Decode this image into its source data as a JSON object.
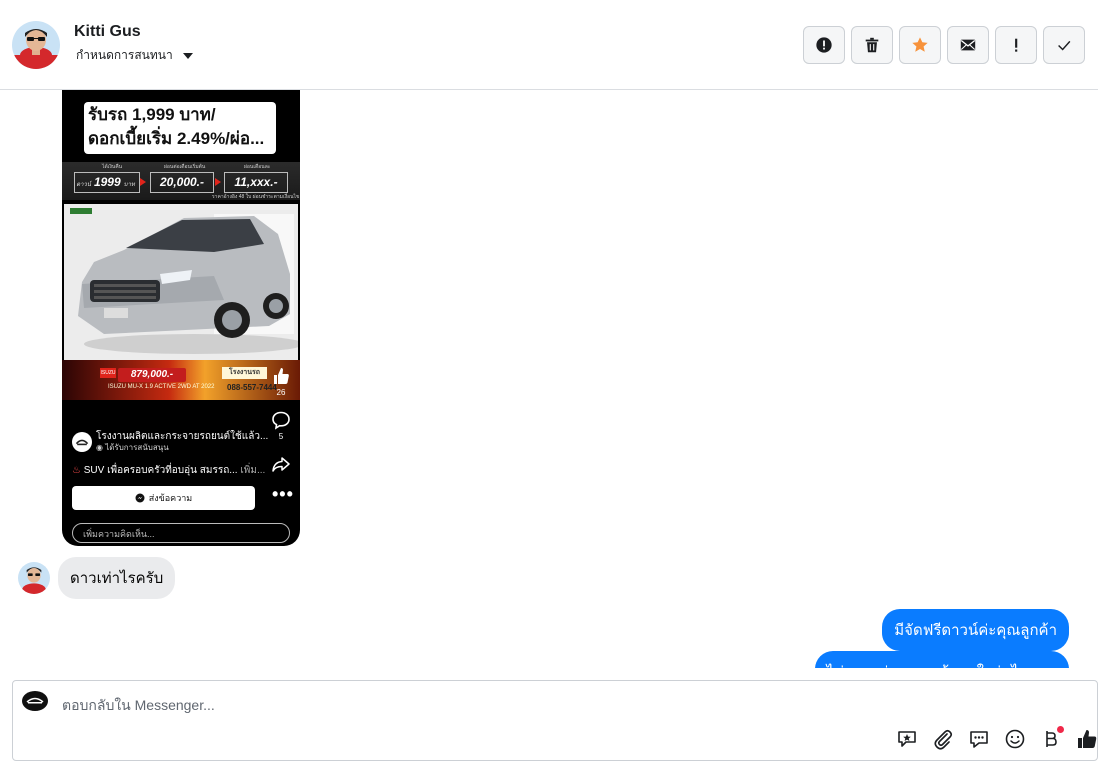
{
  "header": {
    "name": "Kitti Gus",
    "assign_label": "กำหนดการสนทนา",
    "actions": [
      {
        "icon": "alert-circle-icon",
        "name": "spam-button"
      },
      {
        "icon": "trash-icon",
        "name": "delete-button"
      },
      {
        "icon": "star-icon",
        "name": "star-button"
      },
      {
        "icon": "envelope-icon",
        "name": "mark-unread-button"
      },
      {
        "icon": "exclamation-icon",
        "name": "follow-up-button"
      },
      {
        "icon": "check-icon",
        "name": "done-button"
      }
    ],
    "star_color": "#f7923b"
  },
  "post": {
    "title": "รับรถ 1,999 บาท/ ดอกเบี้ยเริ่ม 2.49%/ผ่อ...",
    "price_caps": [
      "ได้เงินคืน",
      "ผ่อนต่อเดือนเริ่มต้น",
      "ผ่อนเดือนละ"
    ],
    "down_prefix": "ดาวน์",
    "down_value": "1999",
    "down_unit": "บาท",
    "cash_value": "20,000.-",
    "monthly_value": "11,xxx.-",
    "strip_note": "ราคาอ้างอิง 48 ใบ ผ่อนชำระตามเงื่อนไข",
    "banner_tag": "ISUZU",
    "banner_price": "879,000.-",
    "banner_sub": "ISUZU MU-X 1.9 ACTIVE 2WD AT 2022",
    "banner_logo": "โรงงานรถ",
    "banner_phone": "088-557-7444",
    "likes": "26",
    "comments": "5",
    "page_name": "โรงงานผลิตและกระจายรถยนต์ใช้แล้ว...",
    "page_sub": "ได้รับการสนับสนุน",
    "caption": "SUV เพื่อครอบครัวที่อบอุ่น สมรรถ...",
    "caption_more": " เพิ่ม...",
    "send_label": "ส่งข้อความ",
    "comment_placeholder": "เพิ่มความคิดเห็น..."
  },
  "messages": {
    "incoming": "ดาวเท่าไรครับ",
    "outgoing_1": "มีจัดฟรีดาวน์ค่ะคุณลูกค้า",
    "outgoing_2": "ไม่ทราบว่าคุณลูกค้าสนใจรุ่นไหนคะ"
  },
  "composer": {
    "placeholder": "ตอบกลับใน Messenger...",
    "tools": [
      "sticker-icon",
      "attach-icon",
      "saved-replies-icon",
      "emoji-icon",
      "payment-icon",
      "thumbs-up-icon"
    ]
  },
  "colors": {
    "outgoing_bubble": "#0a7cff",
    "incoming_bubble": "#eaebed",
    "notification_dot": "#f02849"
  }
}
